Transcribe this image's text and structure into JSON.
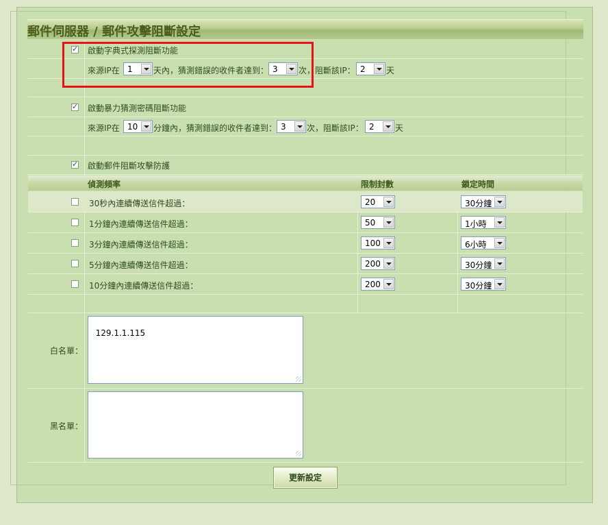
{
  "page": {
    "title": "郵件伺服器 / 郵件攻擊阻斷設定"
  },
  "dictionary_block": {
    "enabled": true,
    "enable_label": "啟動字典式探測阻斷功能",
    "prefix": "來源IP在",
    "days_value": "1",
    "days_suffix": "天內，猜測錯誤的收件者達到：",
    "times_value": "3",
    "times_suffix": "次，阻斷該IP：",
    "block_days_value": "2",
    "block_days_suffix": "天"
  },
  "bruteforce_block": {
    "enabled": true,
    "enable_label": "啟動暴力猜測密碼阻斷功能",
    "prefix": "來源IP在",
    "minutes_value": "10",
    "minutes_suffix": "分鐘內，猜測錯誤的收件者達到：",
    "times_value": "3",
    "times_suffix": "次，阻斷該IP：",
    "block_days_value": "2",
    "block_days_suffix": "天"
  },
  "mail_attack": {
    "enabled": true,
    "enable_label": "啟動郵件阻斷攻擊防護",
    "headers": {
      "frequency": "偵測頻率",
      "limit": "限制封數",
      "lock": "鎖定時間"
    },
    "rules": [
      {
        "checked": false,
        "label": "30秒內連續傳送信件超過：",
        "limit": "20",
        "lock": "30分鐘"
      },
      {
        "checked": false,
        "label": "1分鐘內連續傳送信件超過：",
        "limit": "50",
        "lock": "1小時"
      },
      {
        "checked": false,
        "label": "3分鐘內連續傳送信件超過：",
        "limit": "100",
        "lock": "6小時"
      },
      {
        "checked": false,
        "label": "5分鐘內連續傳送信件超過：",
        "limit": "200",
        "lock": "30分鐘"
      },
      {
        "checked": false,
        "label": "10分鐘內連續傳送信件超過：",
        "limit": "200",
        "lock": "30分鐘"
      }
    ]
  },
  "whitelist": {
    "label": "白名單：",
    "value": "129.1.1.115"
  },
  "blacklist": {
    "label": "黑名單：",
    "value": ""
  },
  "actions": {
    "update_label": "更新設定"
  },
  "colors": {
    "page_bg": "#dfe8cb",
    "panel_bg": "#c9dfb0",
    "title_text": "#4a5d1c",
    "highlight_border": "#e8121a"
  }
}
